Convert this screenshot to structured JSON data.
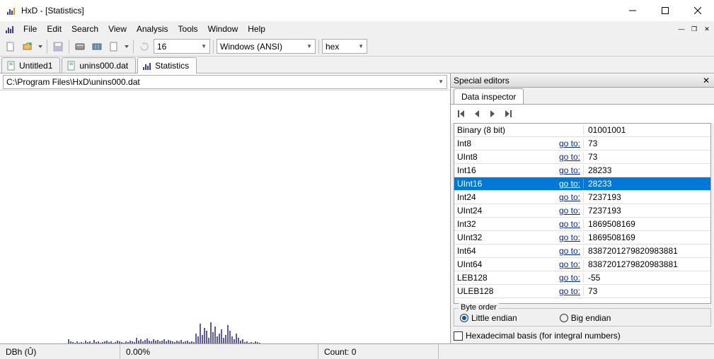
{
  "window": {
    "title": "HxD - [Statistics]"
  },
  "menu": {
    "items": [
      "File",
      "Edit",
      "Search",
      "View",
      "Analysis",
      "Tools",
      "Window",
      "Help"
    ]
  },
  "toolbar": {
    "width_combo": "16",
    "charset_combo": "Windows (ANSI)",
    "base_combo": "hex"
  },
  "tabs": [
    {
      "label": "Untitled1",
      "icon": "doc"
    },
    {
      "label": "unins000.dat",
      "icon": "doc"
    },
    {
      "label": "Statistics",
      "icon": "stat",
      "active": true
    }
  ],
  "path": "C:\\Program Files\\HxD\\unins000.dat",
  "side": {
    "title": "Special editors",
    "tab": "Data inspector",
    "goto": "go to:",
    "rows": [
      {
        "type": "Binary (8 bit)",
        "goto": false,
        "value": "01001001"
      },
      {
        "type": "Int8",
        "goto": true,
        "value": "73"
      },
      {
        "type": "UInt8",
        "goto": true,
        "value": "73"
      },
      {
        "type": "Int16",
        "goto": true,
        "value": "28233"
      },
      {
        "type": "UInt16",
        "goto": true,
        "value": "28233",
        "selected": true
      },
      {
        "type": "Int24",
        "goto": true,
        "value": "7237193"
      },
      {
        "type": "UInt24",
        "goto": true,
        "value": "7237193"
      },
      {
        "type": "Int32",
        "goto": true,
        "value": "1869508169"
      },
      {
        "type": "UInt32",
        "goto": true,
        "value": "1869508169"
      },
      {
        "type": "Int64",
        "goto": true,
        "value": "8387201279820983881"
      },
      {
        "type": "UInt64",
        "goto": true,
        "value": "8387201279820983881"
      },
      {
        "type": "LEB128",
        "goto": true,
        "value": "-55"
      },
      {
        "type": "ULEB128",
        "goto": true,
        "value": "73"
      }
    ],
    "byte_order_label": "Byte order",
    "radio_le": "Little endian",
    "radio_be": "Big endian",
    "byte_order": "le",
    "hex_basis": "Hexadecimal basis (for integral numbers)"
  },
  "status": {
    "left": "DBh (Û)",
    "percent": "0.00%",
    "count": "Count: 0"
  }
}
